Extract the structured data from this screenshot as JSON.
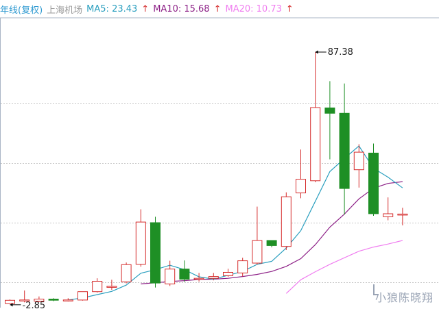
{
  "header": {
    "title": "年线(复权)",
    "stock_name": "上海机场",
    "ma5_label": "MA5: 23.43",
    "ma10_label": "MA10: 15.68",
    "ma20_label": "MA20: 10.73",
    "up_arrow": "↑"
  },
  "colors": {
    "title": "#2f9ad1",
    "stock_name": "#9a9a9a",
    "up_candle": "#d52b2b",
    "down_candle": "#1e8f25",
    "ma5": "#2b9fbf",
    "ma10": "#8c1f86",
    "ma20": "#f07ef0",
    "grid": "#c6c6c6",
    "watermark": "#9aa4b5"
  },
  "chart_data": {
    "type": "candlestick",
    "y_range": [
      0,
      95
    ],
    "grid_values": [
      10,
      30,
      50,
      70
    ],
    "candles": [
      {
        "o": 2.85,
        "c": 3.9,
        "h": 4.2,
        "l": 2.85
      },
      {
        "o": 3.7,
        "c": 4.0,
        "h": 7.2,
        "l": 3.2
      },
      {
        "o": 3.6,
        "c": 4.3,
        "h": 5.2,
        "l": 3.3
      },
      {
        "o": 4.3,
        "c": 3.9,
        "h": 4.6,
        "l": 3.6
      },
      {
        "o": 3.7,
        "c": 4.0,
        "h": 4.6,
        "l": 3.5
      },
      {
        "o": 4.0,
        "c": 6.8,
        "h": 6.8,
        "l": 3.8
      },
      {
        "o": 6.8,
        "c": 10.3,
        "h": 11.3,
        "l": 6.5
      },
      {
        "o": 8.5,
        "c": 8.6,
        "h": 10.8,
        "l": 7.4
      },
      {
        "o": 10.1,
        "c": 15.9,
        "h": 16.6,
        "l": 9.6
      },
      {
        "o": 16.0,
        "c": 30.2,
        "h": 34.5,
        "l": 15.2
      },
      {
        "o": 30.0,
        "c": 9.7,
        "h": 32.0,
        "l": 8.2
      },
      {
        "o": 9.4,
        "c": 14.4,
        "h": 17.2,
        "l": 8.7
      },
      {
        "o": 14.4,
        "c": 11.0,
        "h": 17.3,
        "l": 10.1
      },
      {
        "o": 11.0,
        "c": 11.3,
        "h": 13.1,
        "l": 10.2
      },
      {
        "o": 11.3,
        "c": 11.9,
        "h": 13.1,
        "l": 10.6
      },
      {
        "o": 12.2,
        "c": 13.3,
        "h": 14.5,
        "l": 11.8
      },
      {
        "o": 13.1,
        "c": 17.2,
        "h": 18.2,
        "l": 11.9
      },
      {
        "o": 16.4,
        "c": 24.0,
        "h": 35.4,
        "l": 15.9
      },
      {
        "o": 24.0,
        "c": 22.3,
        "h": 24.0,
        "l": 21.7
      },
      {
        "o": 22.0,
        "c": 38.7,
        "h": 40.2,
        "l": 20.8
      },
      {
        "o": 40.0,
        "c": 44.6,
        "h": 54.6,
        "l": 38.2
      },
      {
        "o": 44.1,
        "c": 68.7,
        "h": 87.38,
        "l": 43.6
      },
      {
        "o": 68.6,
        "c": 66.8,
        "h": 77.6,
        "l": 51.3
      },
      {
        "o": 66.8,
        "c": 41.5,
        "h": 76.8,
        "l": 32.7
      },
      {
        "o": 47.8,
        "c": 53.7,
        "h": 56.4,
        "l": 41.8
      },
      {
        "o": 53.4,
        "c": 33.0,
        "h": 56.6,
        "l": 32.3
      },
      {
        "o": 32.0,
        "c": 33.0,
        "h": 38.5,
        "l": 30.8
      },
      {
        "o": 32.9,
        "c": 32.9,
        "h": 35.0,
        "l": 29.1
      }
    ],
    "ma5": [
      null,
      null,
      null,
      null,
      4.0,
      4.7,
      5.8,
      6.9,
      9.0,
      13.0,
      14.2,
      15.7,
      14.2,
      11.8,
      11.0,
      12.3,
      13.6,
      16.0,
      17.0,
      21.5,
      27.3,
      37.2,
      47.2,
      51.6,
      55.8,
      48.3,
      45.3,
      41.7
    ],
    "ma10": [
      null,
      null,
      null,
      null,
      null,
      null,
      null,
      null,
      null,
      9.4,
      9.8,
      10.2,
      10.5,
      10.9,
      11.0,
      11.3,
      11.9,
      12.6,
      13.6,
      15.3,
      17.9,
      22.6,
      28.5,
      32.9,
      38.0,
      41.6,
      43.2,
      43.8
    ],
    "ma20": [
      null,
      null,
      null,
      null,
      null,
      null,
      null,
      null,
      null,
      null,
      null,
      null,
      null,
      null,
      null,
      null,
      null,
      null,
      null,
      6.2,
      10.8,
      13.5,
      16.0,
      18.2,
      20.4,
      21.8,
      22.8,
      24.0
    ],
    "max_label": "87.38",
    "min_label": "2.85"
  },
  "watermark": "小狼陈晓翔"
}
